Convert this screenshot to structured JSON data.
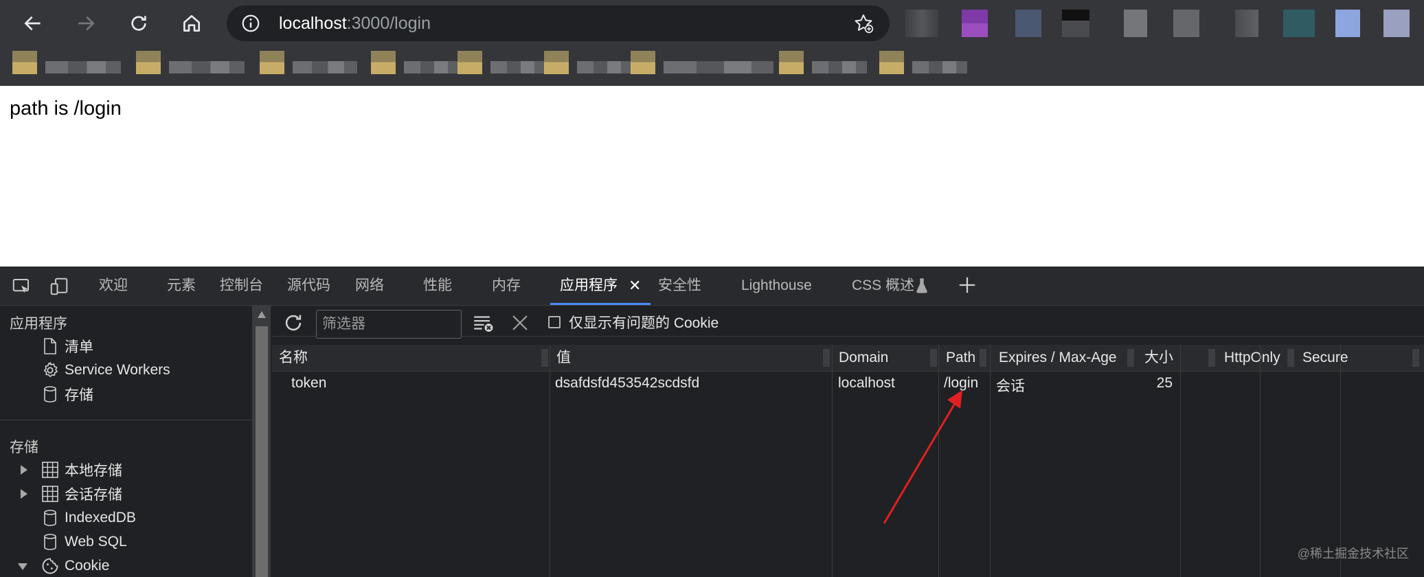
{
  "browser": {
    "url_host": "localhost",
    "url_rest": ":3000/login"
  },
  "page": {
    "text": "path is /login"
  },
  "devtools": {
    "tabs": [
      {
        "label": "欢迎"
      },
      {
        "label": "元素"
      },
      {
        "label": "控制台"
      },
      {
        "label": "源代码"
      },
      {
        "label": "网络"
      },
      {
        "label": "性能"
      },
      {
        "label": "内存"
      },
      {
        "label": "应用程序",
        "active": true
      },
      {
        "label": "安全性"
      },
      {
        "label": "Lighthouse"
      },
      {
        "label": "CSS 概述"
      }
    ],
    "sidebar": {
      "app_heading": "应用程序",
      "app_items": [
        {
          "label": "清单",
          "icon": "file-icon"
        },
        {
          "label": "Service Workers",
          "icon": "gear-icon"
        },
        {
          "label": "存储",
          "icon": "database-icon"
        }
      ],
      "storage_heading": "存储",
      "storage_items": [
        {
          "label": "本地存储",
          "icon": "grid-icon"
        },
        {
          "label": "会话存储",
          "icon": "grid-icon"
        },
        {
          "label": "IndexedDB",
          "icon": "database-icon"
        },
        {
          "label": "Web SQL",
          "icon": "database-icon"
        },
        {
          "label": "Cookie",
          "icon": "cookie-icon"
        }
      ]
    },
    "toolbar": {
      "filter_placeholder": "筛选器",
      "only_issues_label": "仅显示有问题的 Cookie"
    },
    "cookies": {
      "columns": [
        "名称",
        "值",
        "Domain",
        "Path",
        "Expires / Max-Age",
        "大小",
        "HttpOnly",
        "Secure"
      ],
      "rows": [
        {
          "name": "token",
          "value": "dsafdsfd453542scdsfd",
          "domain": "localhost",
          "path": "/login",
          "expires": "会话",
          "size": "25",
          "httponly": "",
          "secure": ""
        }
      ]
    },
    "annotation_arrow_color": "#e02020"
  },
  "watermark": "@稀土掘金技术社区"
}
